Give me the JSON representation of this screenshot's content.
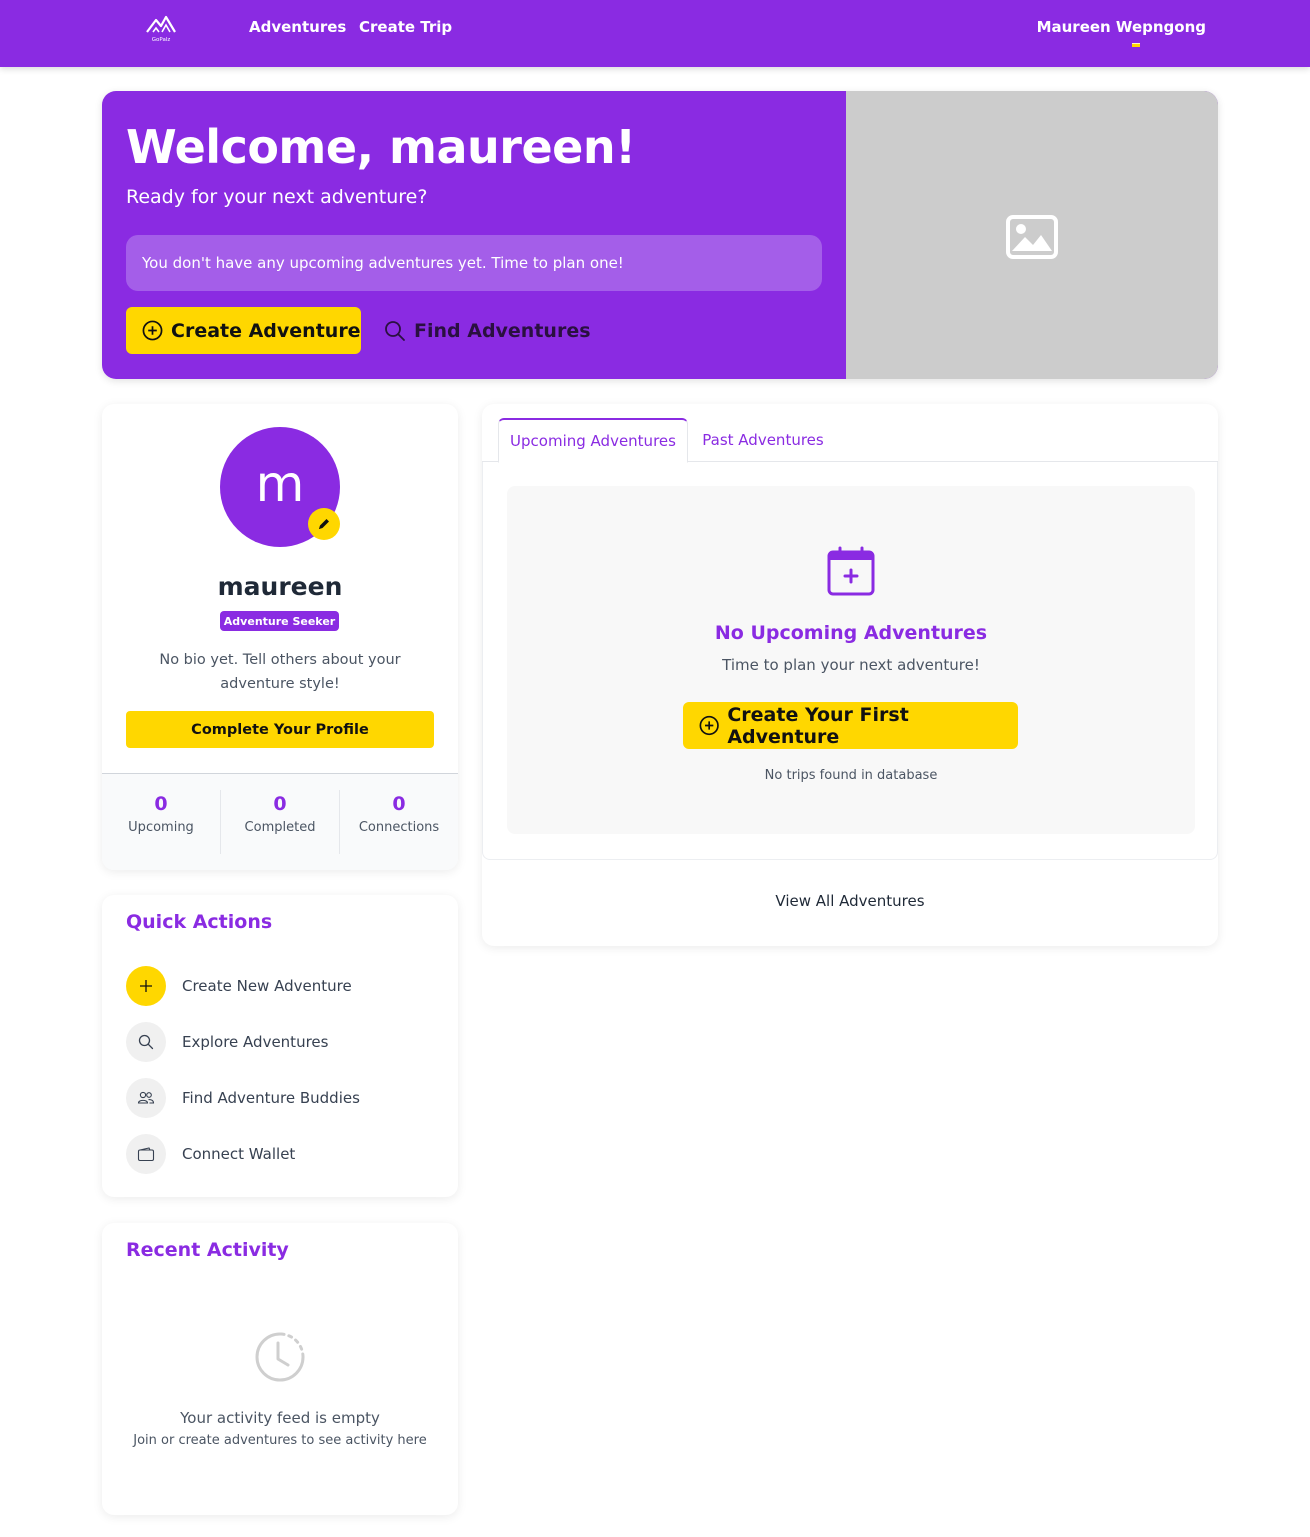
{
  "header": {
    "logo_text": "GoPalz",
    "nav": {
      "adventures": "Adventures",
      "create_trip": "Create Trip"
    },
    "user_name": "Maureen Wepngong"
  },
  "hero": {
    "title": "Welcome, maureen!",
    "subtitle": "Ready for your next adventure?",
    "notice": "You don't have any upcoming adventures yet. Time to plan one!",
    "create_button": "Create Adventure",
    "find_button": "Find Adventures"
  },
  "profile": {
    "avatar_initial": "m",
    "name": "maureen",
    "badge": "Adventure Seeker",
    "bio": "No bio yet. Tell others about your adventure style!",
    "complete_button": "Complete Your Profile",
    "stats": [
      {
        "value": "0",
        "label": "Upcoming"
      },
      {
        "value": "0",
        "label": "Completed"
      },
      {
        "value": "0",
        "label": "Connections"
      }
    ]
  },
  "quick_actions": {
    "title": "Quick Actions",
    "items": [
      {
        "label": "Create New Adventure",
        "icon": "plus-icon"
      },
      {
        "label": "Explore Adventures",
        "icon": "search-icon"
      },
      {
        "label": "Find Adventure Buddies",
        "icon": "people-icon"
      },
      {
        "label": "Connect Wallet",
        "icon": "wallet-icon"
      }
    ]
  },
  "recent_activity": {
    "title": "Recent Activity",
    "empty": "Your activity feed is empty",
    "hint": "Join or create adventures to see activity here"
  },
  "adventures": {
    "tabs": [
      {
        "label": "Upcoming Adventures",
        "active": true
      },
      {
        "label": "Past Adventures",
        "active": false
      }
    ],
    "empty_title": "No Upcoming Adventures",
    "empty_subtitle": "Time to plan your next adventure!",
    "create_button": "Create Your First Adventure",
    "note": "No trips found in database",
    "view_all": "View All Adventures"
  },
  "colors": {
    "brand_purple": "#8a2be2",
    "accent_yellow": "#ffd700",
    "image_placeholder": "#cccccc"
  }
}
